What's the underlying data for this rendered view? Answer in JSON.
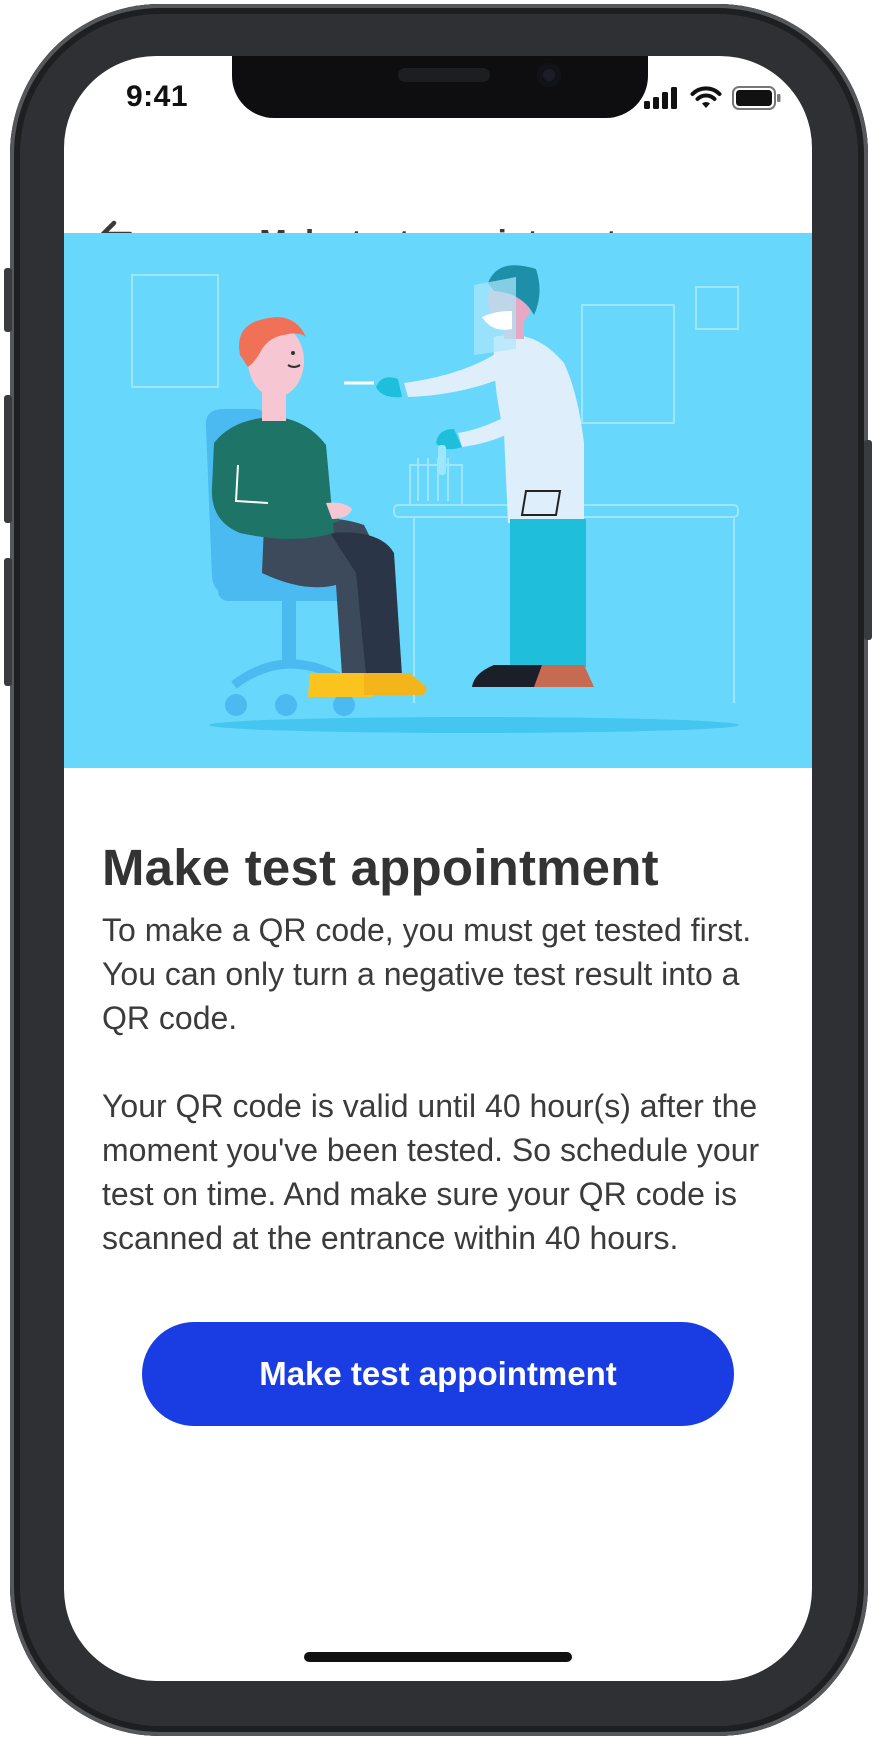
{
  "status_bar": {
    "time": "9:41",
    "icons": [
      "cellular-signal-icon",
      "wifi-icon",
      "battery-icon"
    ]
  },
  "nav": {
    "back_icon": "arrow-left-icon",
    "title": "Make test appointment"
  },
  "hero": {
    "illustration": "patient-receiving-swab-test-illustration"
  },
  "content": {
    "heading": "Make test appointment",
    "paragraph_1": "To make a QR code, you must get tested first. You can only turn a negative test result into a QR code.",
    "paragraph_2": "Your QR code is valid until 40 hour(s) after the moment you've been tested. So schedule your test on time. And make sure your QR code is scanned at the entrance within 40 hours."
  },
  "cta": {
    "label": "Make test appointment"
  },
  "colors": {
    "hero_background": "#67d8fb",
    "primary_button": "#1a3de3",
    "text": "#333333"
  }
}
